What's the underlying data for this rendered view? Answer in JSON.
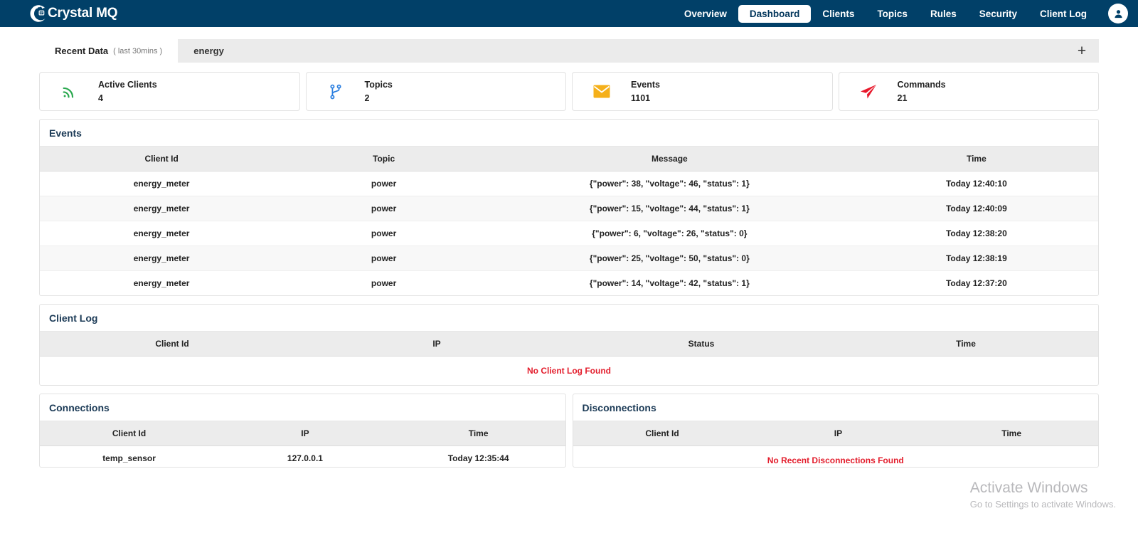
{
  "header": {
    "brand": "Crystal MQ",
    "brand_logo_icon": "crystal-c-logo",
    "avatar_icon": "user-avatar-icon",
    "nav": [
      {
        "label": "Overview",
        "active": false
      },
      {
        "label": "Dashboard",
        "active": true
      },
      {
        "label": "Clients",
        "active": false
      },
      {
        "label": "Topics",
        "active": false
      },
      {
        "label": "Rules",
        "active": false
      },
      {
        "label": "Security",
        "active": false
      },
      {
        "label": "Client Log",
        "active": false
      }
    ]
  },
  "tabs": {
    "items": [
      {
        "label": "Recent Data",
        "sub": "( last 30mins )",
        "active": true
      },
      {
        "label": "energy",
        "sub": "",
        "active": false
      }
    ],
    "add_label": "+"
  },
  "stats": [
    {
      "icon": "signal-rss-icon",
      "color": "#2aa84f",
      "label": "Active Clients",
      "value": "4"
    },
    {
      "icon": "code-branch-icon",
      "color": "#2b7fe0",
      "label": "Topics",
      "value": "2"
    },
    {
      "icon": "envelope-icon",
      "color": "#f5b01a",
      "label": "Events",
      "value": "1101"
    },
    {
      "icon": "paper-plane-icon",
      "color": "#e8192c",
      "label": "Commands",
      "value": "21"
    }
  ],
  "events_panel": {
    "title": "Events",
    "columns": [
      "Client Id",
      "Topic",
      "Message",
      "Time"
    ],
    "rows": [
      [
        "energy_meter",
        "power",
        "{\"power\": 38, \"voltage\": 46, \"status\": 1}",
        "Today 12:40:10"
      ],
      [
        "energy_meter",
        "power",
        "{\"power\": 15, \"voltage\": 44, \"status\": 1}",
        "Today 12:40:09"
      ],
      [
        "energy_meter",
        "power",
        "{\"power\": 6, \"voltage\": 26, \"status\": 0}",
        "Today 12:38:20"
      ],
      [
        "energy_meter",
        "power",
        "{\"power\": 25, \"voltage\": 50, \"status\": 0}",
        "Today 12:38:19"
      ],
      [
        "energy_meter",
        "power",
        "{\"power\": 14, \"voltage\": 42, \"status\": 1}",
        "Today 12:37:20"
      ]
    ]
  },
  "client_log_panel": {
    "title": "Client Log",
    "columns": [
      "Client Id",
      "IP",
      "Status",
      "Time"
    ],
    "rows": [],
    "empty_message": "No Client Log Found"
  },
  "connections_panel": {
    "title": "Connections",
    "columns": [
      "Client Id",
      "IP",
      "Time"
    ],
    "rows": [
      [
        "temp_sensor",
        "127.0.0.1",
        "Today 12:35:44"
      ]
    ]
  },
  "disconnections_panel": {
    "title": "Disconnections",
    "columns": [
      "Client Id",
      "IP",
      "Time"
    ],
    "rows": [],
    "empty_message": "No Recent Disconnections Found"
  },
  "watermark": {
    "title": "Activate Windows",
    "subtitle": "Go to Settings to activate Windows."
  },
  "colors": {
    "header_blue": "#014068",
    "accent_red": "#e31e2d",
    "tabstrip_gray": "#ebebeb"
  }
}
